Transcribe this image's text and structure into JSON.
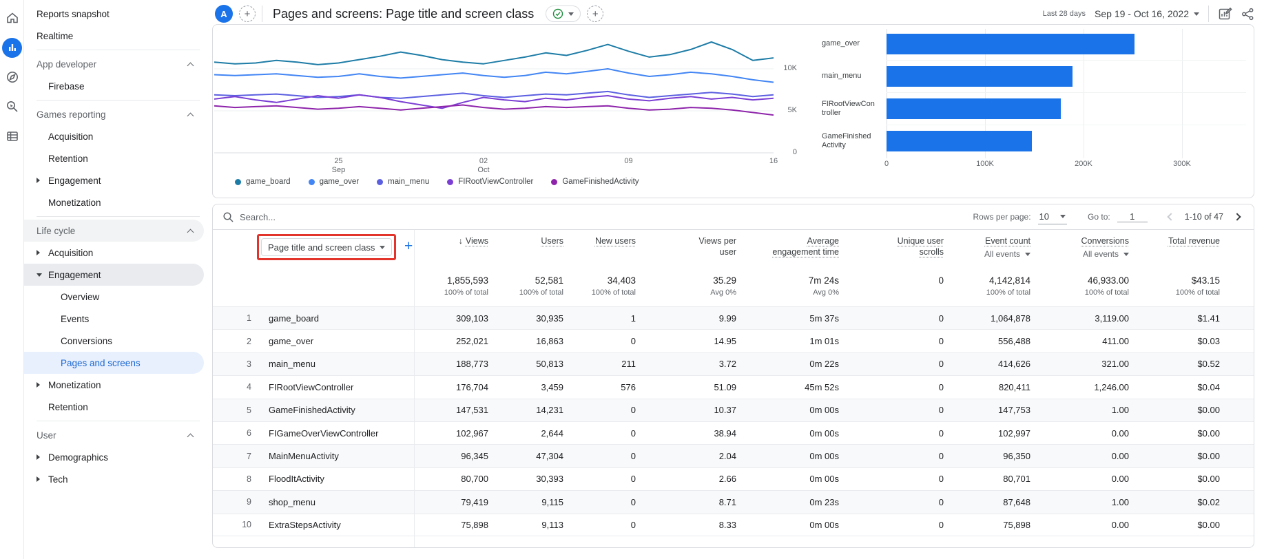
{
  "icon_rail": {
    "items": [
      {
        "icon": "home-icon"
      },
      {
        "icon": "reports-icon",
        "active": true
      },
      {
        "icon": "explore-icon"
      },
      {
        "icon": "advertising-icon"
      },
      {
        "icon": "library-icon"
      }
    ]
  },
  "sidebar": {
    "groups": [
      {
        "items": [
          {
            "label": "Reports snapshot",
            "indent": 1
          },
          {
            "label": "Realtime",
            "indent": 1
          }
        ]
      },
      {
        "header": "App developer",
        "items": [
          {
            "label": "Firebase",
            "indent": 2
          }
        ]
      },
      {
        "header": "Games reporting",
        "items": [
          {
            "label": "Acquisition",
            "indent": 2
          },
          {
            "label": "Retention",
            "indent": 2
          },
          {
            "label": "Engagement",
            "indent": 2,
            "arrow": "right"
          },
          {
            "label": "Monetization",
            "indent": 2
          }
        ]
      },
      {
        "header": "Life cycle",
        "header_bg": true,
        "items": [
          {
            "label": "Acquisition",
            "indent": 2,
            "arrow": "right"
          },
          {
            "label": "Engagement",
            "indent": 2,
            "arrow": "down",
            "pill": true
          },
          {
            "label": "Overview",
            "indent": 3
          },
          {
            "label": "Events",
            "indent": 3
          },
          {
            "label": "Conversions",
            "indent": 3
          },
          {
            "label": "Pages and screens",
            "indent": 3,
            "selected": true
          },
          {
            "label": "Monetization",
            "indent": 2,
            "arrow": "right"
          },
          {
            "label": "Retention",
            "indent": 2
          }
        ]
      },
      {
        "header": "User",
        "items": [
          {
            "label": "Demographics",
            "indent": 2,
            "arrow": "right"
          },
          {
            "label": "Tech",
            "indent": 2,
            "arrow": "right"
          }
        ]
      }
    ]
  },
  "topbar": {
    "avatar_letter": "A",
    "title": "Pages and screens: Page title and screen class",
    "date_preset": "Last 28 days",
    "date_range": "Sep 19 - Oct 16, 2022"
  },
  "chart_data": [
    {
      "type": "line",
      "n_points": 28,
      "ylim": [
        0,
        15250
      ],
      "y_ticks": [
        {
          "v": 0,
          "label": "0"
        },
        {
          "v": 5000,
          "label": "5K"
        },
        {
          "v": 10000,
          "label": "10K"
        }
      ],
      "x_ticks": [
        {
          "i": 6,
          "l1": "25",
          "l2": "Sep"
        },
        {
          "i": 13,
          "l1": "02",
          "l2": "Oct"
        },
        {
          "i": 20,
          "l1": "09",
          "l2": ""
        },
        {
          "i": 27,
          "l1": "16",
          "l2": ""
        }
      ],
      "series": [
        {
          "name": "game_board",
          "color": "#1d7ca6",
          "values": [
            10800,
            10600,
            10700,
            11000,
            10800,
            10500,
            10700,
            11100,
            11500,
            12000,
            11600,
            11100,
            10800,
            10600,
            11000,
            11400,
            11900,
            11600,
            12200,
            12900,
            12100,
            11400,
            11700,
            12300,
            13200,
            12300,
            11000,
            11300
          ]
        },
        {
          "name": "game_over",
          "color": "#4285f4",
          "values": [
            9300,
            9200,
            9300,
            9400,
            9200,
            9000,
            9100,
            9400,
            9100,
            8900,
            9100,
            9300,
            9500,
            9200,
            9000,
            9200,
            9600,
            9400,
            9700,
            10000,
            9500,
            9100,
            9300,
            9600,
            9400,
            9100,
            8700,
            8400
          ]
        },
        {
          "name": "main_menu",
          "color": "#5b5fe0",
          "values": [
            6900,
            6800,
            6900,
            7000,
            6800,
            6600,
            6700,
            6900,
            6600,
            6500,
            6700,
            6900,
            7100,
            6800,
            6600,
            6800,
            7000,
            6900,
            7100,
            7300,
            6900,
            6600,
            6800,
            7000,
            7200,
            7000,
            6700,
            6900
          ]
        },
        {
          "name": "FIRootViewController",
          "color": "#7b3fd4",
          "values": [
            6400,
            6700,
            6300,
            6000,
            6400,
            6800,
            6500,
            6900,
            6600,
            6100,
            5700,
            5300,
            6000,
            6600,
            6300,
            6100,
            6500,
            6300,
            6600,
            6800,
            6400,
            6200,
            6500,
            6700,
            6400,
            6600,
            6300,
            6500
          ]
        },
        {
          "name": "GameFinishedActivity",
          "color": "#8e24aa",
          "values": [
            5600,
            5400,
            5500,
            5600,
            5400,
            5200,
            5300,
            5500,
            5300,
            5100,
            5300,
            5500,
            5700,
            5400,
            5200,
            5300,
            5500,
            5400,
            5500,
            5600,
            5300,
            5100,
            5200,
            5400,
            5300,
            5100,
            4800,
            4500
          ]
        }
      ]
    },
    {
      "type": "bar",
      "orientation": "horizontal",
      "bar_color": "#1a73e8",
      "categories": [
        "game_over",
        "main_menu",
        "FIRootViewController",
        "GameFinishedActivity"
      ],
      "values": [
        252021,
        188773,
        176704,
        147531
      ],
      "xlim": [
        0,
        365000
      ],
      "x_ticks": [
        {
          "v": 0,
          "label": "0"
        },
        {
          "v": 100000,
          "label": "100K"
        },
        {
          "v": 200000,
          "label": "200K"
        },
        {
          "v": 300000,
          "label": "300K"
        }
      ]
    }
  ],
  "table": {
    "search_placeholder": "Search...",
    "rows_per_page_label": "Rows per page:",
    "rows_per_page_value": "10",
    "goto_label": "Go to:",
    "goto_value": "1",
    "pagination": "1-10 of 47",
    "dimension_dropdown": "Page title and screen class",
    "columns": [
      {
        "label": "Views",
        "sorted": true,
        "dotted": true,
        "total": "1,855,593",
        "subtotal": "100% of total"
      },
      {
        "label": "Users",
        "dotted": true,
        "total": "52,581",
        "subtotal": "100% of total"
      },
      {
        "label": "New users",
        "dotted": true,
        "total": "34,403",
        "subtotal": "100% of total"
      },
      {
        "label": "Views per user",
        "dotted": false,
        "total": "35.29",
        "subtotal": "Avg 0%"
      },
      {
        "label": "Average engagement time",
        "dotted": true,
        "total": "7m 24s",
        "subtotal": "Avg 0%"
      },
      {
        "label": "Unique user scrolls",
        "dotted": true,
        "total": "0",
        "subtotal": ""
      },
      {
        "label": "Event count",
        "sublabel": "All events",
        "dotted": true,
        "total": "4,142,814",
        "subtotal": "100% of total"
      },
      {
        "label": "Conversions",
        "sublabel": "All events",
        "dotted": true,
        "total": "46,933.00",
        "subtotal": "100% of total"
      },
      {
        "label": "Total revenue",
        "dotted": true,
        "total": "$43.15",
        "subtotal": "100% of total"
      }
    ],
    "rows": [
      {
        "index": "1",
        "name": "game_board",
        "values": [
          "309,103",
          "30,935",
          "1",
          "9.99",
          "5m 37s",
          "0",
          "1,064,878",
          "3,119.00",
          "$1.41"
        ]
      },
      {
        "index": "2",
        "name": "game_over",
        "values": [
          "252,021",
          "16,863",
          "0",
          "14.95",
          "1m 01s",
          "0",
          "556,488",
          "411.00",
          "$0.03"
        ]
      },
      {
        "index": "3",
        "name": "main_menu",
        "values": [
          "188,773",
          "50,813",
          "211",
          "3.72",
          "0m 22s",
          "0",
          "414,626",
          "321.00",
          "$0.52"
        ]
      },
      {
        "index": "4",
        "name": "FIRootViewController",
        "values": [
          "176,704",
          "3,459",
          "576",
          "51.09",
          "45m 52s",
          "0",
          "820,411",
          "1,246.00",
          "$0.04"
        ]
      },
      {
        "index": "5",
        "name": "GameFinishedActivity",
        "values": [
          "147,531",
          "14,231",
          "0",
          "10.37",
          "0m 00s",
          "0",
          "147,753",
          "1.00",
          "$0.00"
        ]
      },
      {
        "index": "6",
        "name": "FIGameOverViewController",
        "values": [
          "102,967",
          "2,644",
          "0",
          "38.94",
          "0m 00s",
          "0",
          "102,997",
          "0.00",
          "$0.00"
        ]
      },
      {
        "index": "7",
        "name": "MainMenuActivity",
        "values": [
          "96,345",
          "47,304",
          "0",
          "2.04",
          "0m 00s",
          "0",
          "96,350",
          "0.00",
          "$0.00"
        ]
      },
      {
        "index": "8",
        "name": "FloodItActivity",
        "values": [
          "80,700",
          "30,393",
          "0",
          "2.66",
          "0m 00s",
          "0",
          "80,701",
          "0.00",
          "$0.00"
        ]
      },
      {
        "index": "9",
        "name": "shop_menu",
        "values": [
          "79,419",
          "9,115",
          "0",
          "8.71",
          "0m 23s",
          "0",
          "87,648",
          "1.00",
          "$0.02"
        ]
      },
      {
        "index": "10",
        "name": "ExtraStepsActivity",
        "values": [
          "75,898",
          "9,113",
          "0",
          "8.33",
          "0m 00s",
          "0",
          "75,898",
          "0.00",
          "$0.00"
        ]
      }
    ]
  }
}
